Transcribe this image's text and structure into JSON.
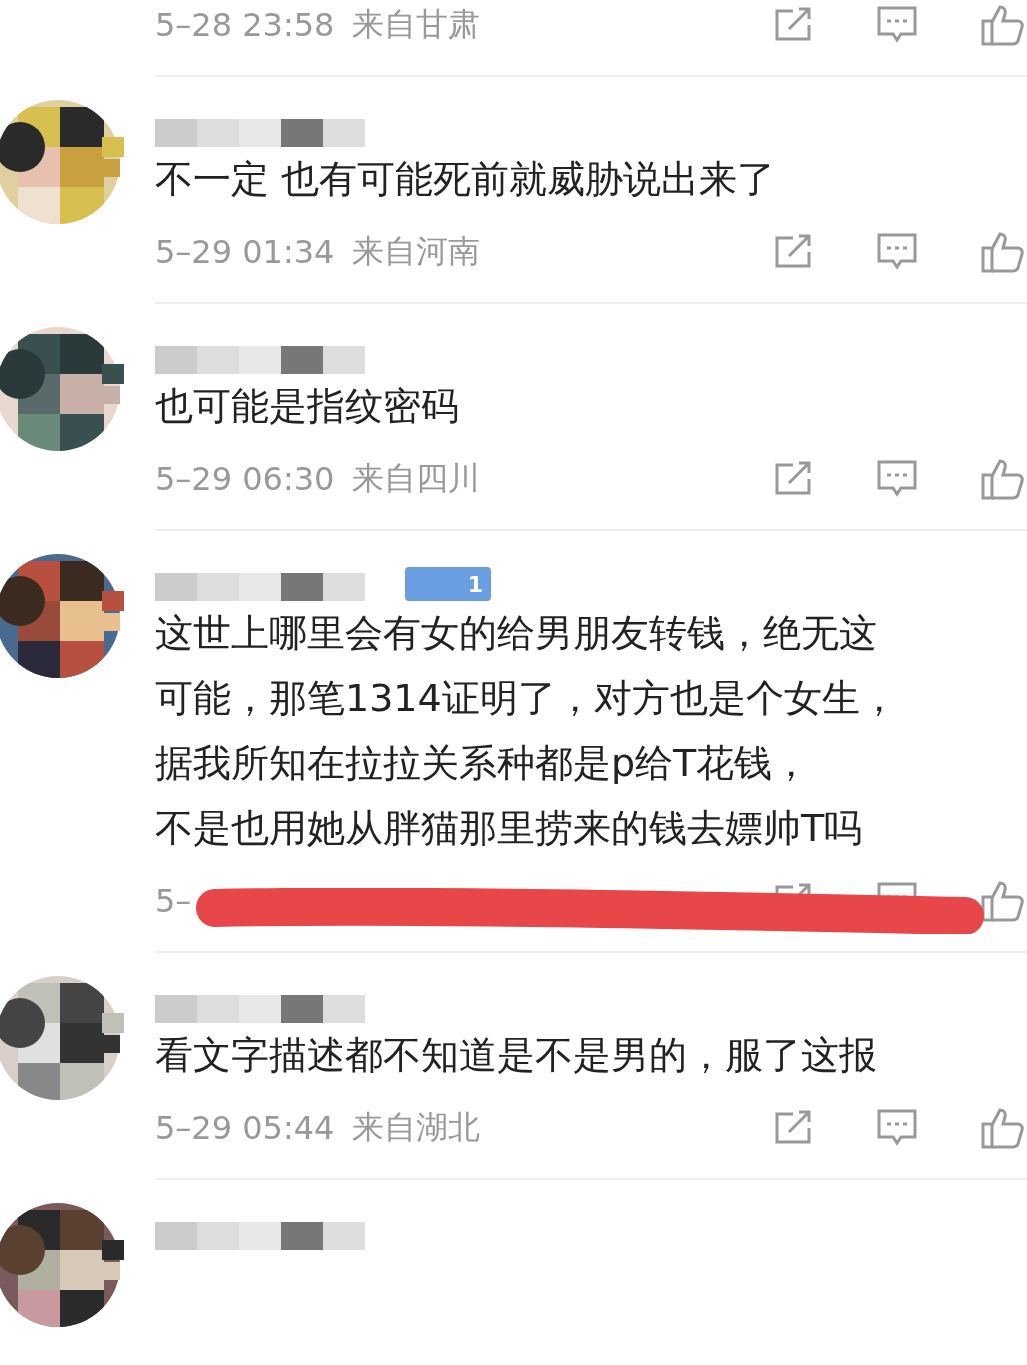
{
  "comments": [
    {
      "name_hidden": false,
      "time": "5–28 23:58",
      "location": "来自甘肃",
      "marked_over": false
    },
    {
      "name_hidden": true,
      "body_lines": [
        "不一定 也有可能死前就威胁说出来了"
      ],
      "time": "5–29 01:34",
      "location": "来自河南",
      "marked_over": false
    },
    {
      "name_hidden": true,
      "body_lines": [
        "也可能是指纹密码"
      ],
      "time": "5–29 06:30",
      "location": "来自四川",
      "marked_over": false
    },
    {
      "name_hidden": true,
      "badge": "1",
      "body_lines": [
        "这世上哪里会有女的给男朋友转钱，绝无这",
        "可能，那笔1314证明了，对方也是个女生，",
        "据我所知在拉拉关系种都是p给T花钱，",
        "不是也用她从胖猫那里捞来的钱去嫖帅T吗"
      ],
      "time": "5–",
      "marked_over": true
    },
    {
      "name_hidden": true,
      "body_lines": [
        "看文字描述都不知道是不是男的，服了这报"
      ],
      "time": "5–29 05:44",
      "location": "来自湖北",
      "marked_over": false
    },
    {
      "name_hidden": true,
      "marked_over": false
    }
  ]
}
